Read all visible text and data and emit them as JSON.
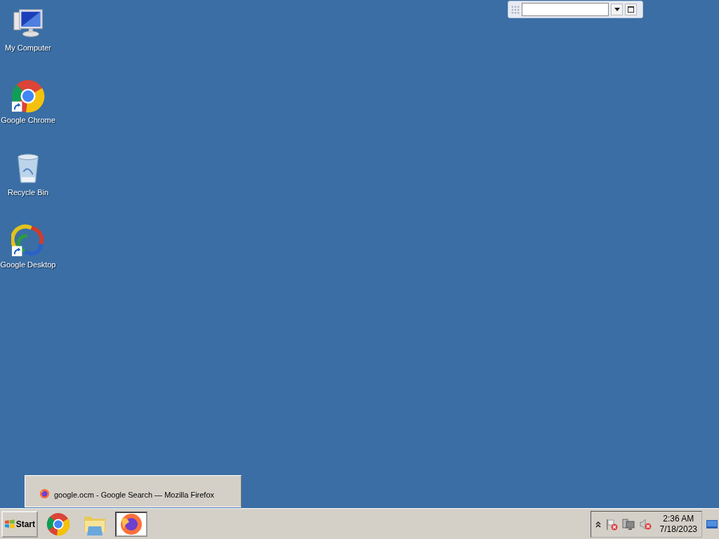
{
  "desktop_icons": [
    {
      "kind": "computer",
      "label": "My Computer",
      "shortcut": false
    },
    {
      "kind": "chrome",
      "label": "Google Chrome",
      "shortcut": true
    },
    {
      "kind": "recycle",
      "label": "Recycle Bin",
      "shortcut": false
    },
    {
      "kind": "swirl",
      "label": "Google Desktop",
      "shortcut": true
    }
  ],
  "tooltip": {
    "title": "google.ocm - Google Search — Mozilla Firefox"
  },
  "taskbar": {
    "start": "Start",
    "buttons": [
      {
        "kind": "chrome",
        "selected": false
      },
      {
        "kind": "folder",
        "selected": false
      },
      {
        "kind": "firefox",
        "selected": true
      }
    ],
    "tray": {
      "time": "2:36 AM",
      "date": "7/18/2023"
    }
  }
}
